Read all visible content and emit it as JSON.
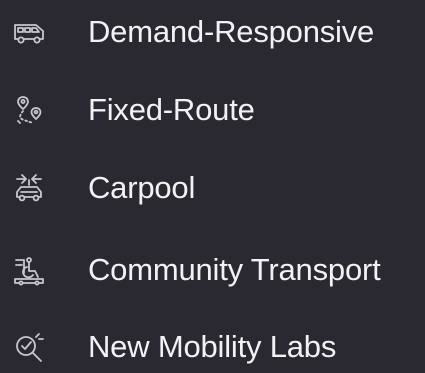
{
  "menu": {
    "items": [
      {
        "label": "Demand-Responsive",
        "icon": "van-icon"
      },
      {
        "label": "Fixed-Route",
        "icon": "route-pins-icon"
      },
      {
        "label": "Carpool",
        "icon": "carpool-icon"
      },
      {
        "label": "Community Transport",
        "icon": "wheelchair-van-icon"
      },
      {
        "label": "New Mobility Labs",
        "icon": "lab-search-icon"
      }
    ],
    "colors": {
      "background": "#2a2830",
      "text": "#f2f1f4",
      "icon": "#c9c6cf"
    }
  }
}
